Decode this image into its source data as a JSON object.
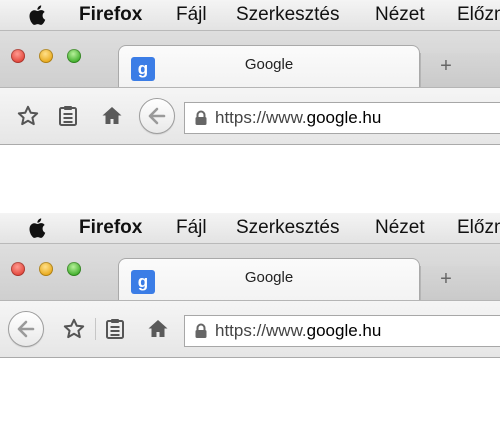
{
  "menubar": {
    "app_name": "Firefox",
    "items": [
      "Fájl",
      "Szerkesztés",
      "Nézet",
      "Előzm"
    ]
  },
  "tab": {
    "favicon_letter": "g",
    "title": "Google"
  },
  "newtab_label": "+",
  "url": {
    "prefix": "https://www.",
    "domain": "google.hu"
  }
}
